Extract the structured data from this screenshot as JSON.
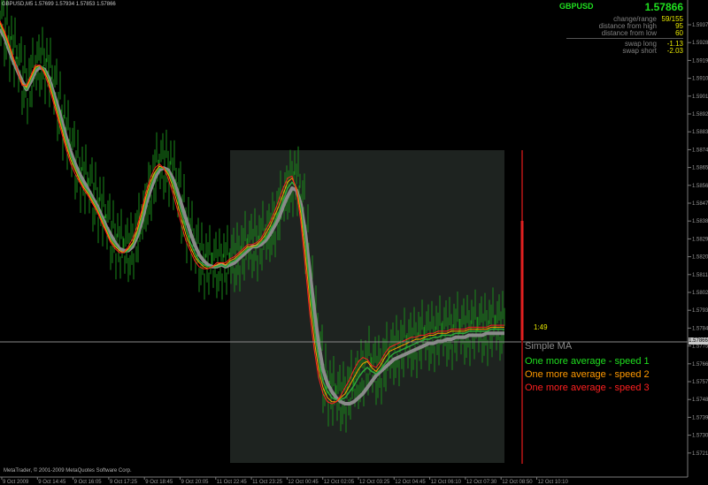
{
  "window": {
    "title": "GBPUSD,M5  1.57699 1.57934 1.57853 1.57866",
    "copyright": "MetaTrader, © 2001-2009 MetaQuotes Software Corp."
  },
  "info_panel": {
    "symbol": "GBPUSD",
    "price": "1.57866",
    "rows": [
      {
        "label": "change/range",
        "value": "59/155"
      },
      {
        "label": "distance from high",
        "value": "95"
      },
      {
        "label": "distance from low",
        "value": "60"
      },
      {
        "label": "swap long",
        "value": "-1.13"
      },
      {
        "label": "swap short",
        "value": "-2.03"
      }
    ]
  },
  "timer": "1:49",
  "current_price_tag": "1.57866",
  "legend": [
    {
      "label": "Simple MA",
      "color": "#8a8a8a"
    },
    {
      "label": "One more average - speed 1",
      "color": "#1fe01f"
    },
    {
      "label": "One more average - speed 2",
      "color": "#ff9900"
    },
    {
      "label": "One more average - speed 3",
      "color": "#ff2020"
    }
  ],
  "colors": {
    "background": "#000000",
    "bars": "#1a8a1a",
    "highlight_box": "#1e2320",
    "axis_text": "#9a9a9a",
    "red_bar": "#e02020",
    "price_line": "#8a8a8a"
  },
  "chart_data": {
    "type": "line",
    "symbol": "GBPUSD",
    "timeframe": "M5",
    "x_ticks": [
      "9 Oct 2009",
      "9 Oct 14:45",
      "9 Oct 16:05",
      "9 Oct 17:25",
      "9 Oct 18:45",
      "9 Oct 20:05",
      "11 Oct 22:45",
      "11 Oct 23:25",
      "12 Oct 00:45",
      "12 Oct 02:05",
      "12 Oct 03:25",
      "12 Oct 04:45",
      "12 Oct 06:10",
      "12 Oct 07:30",
      "12 Oct 08:50",
      "12 Oct 10:10"
    ],
    "y_ticks": [
      "1.59375",
      "1.59285",
      "1.59195",
      "1.59105",
      "1.59015",
      "1.58925",
      "1.58835",
      "1.58745",
      "1.58655",
      "1.58565",
      "1.58475",
      "1.58385",
      "1.58295",
      "1.58205",
      "1.58115",
      "1.58025",
      "1.57935",
      "1.57845",
      "1.57755",
      "1.57665",
      "1.57575",
      "1.57485",
      "1.57395",
      "1.57305",
      "1.57215"
    ],
    "ylim": [
      1.5718,
      1.5946
    ],
    "x": [
      0,
      5,
      10,
      15,
      20,
      25,
      30,
      35,
      40,
      45,
      50,
      55,
      60,
      65,
      70,
      75,
      80,
      85,
      90,
      95,
      100,
      105,
      110,
      115,
      120,
      125,
      130,
      135,
      140,
      145,
      150,
      155,
      160,
      165,
      170,
      175,
      180,
      185,
      190,
      195,
      200,
      205,
      210,
      215,
      220,
      225,
      230,
      235,
      240,
      245,
      250,
      255,
      260,
      265,
      270,
      275,
      280,
      285,
      290,
      295,
      300,
      305,
      310,
      315,
      320,
      325,
      330,
      335,
      340,
      345,
      350,
      355,
      360,
      365,
      370,
      375,
      380,
      385,
      390,
      395,
      400,
      405,
      410,
      415,
      420,
      425,
      430,
      435,
      440,
      445,
      450,
      455,
      460,
      465,
      470,
      475,
      480,
      485,
      490,
      495,
      500,
      505,
      510,
      515,
      520,
      525,
      530,
      535,
      540,
      545,
      550,
      555,
      560,
      565,
      570
    ],
    "series": [
      {
        "name": "Simple MA",
        "values": [
          1.5936,
          1.5932,
          1.5926,
          1.592,
          1.5915,
          1.591,
          1.5906,
          1.591,
          1.5915,
          1.5917,
          1.5916,
          1.5912,
          1.5905,
          1.5898,
          1.589,
          1.5882,
          1.5875,
          1.5869,
          1.5864,
          1.586,
          1.5856,
          1.5852,
          1.5848,
          1.5843,
          1.5838,
          1.5834,
          1.583,
          1.5827,
          1.5826,
          1.5826,
          1.5828,
          1.5833,
          1.584,
          1.5849,
          1.5856,
          1.5862,
          1.5866,
          1.5867,
          1.5866,
          1.5862,
          1.5856,
          1.5849,
          1.5842,
          1.5835,
          1.5829,
          1.5824,
          1.5821,
          1.5819,
          1.5818,
          1.5818,
          1.5819,
          1.5818,
          1.5819,
          1.582,
          1.5822,
          1.5824,
          1.5826,
          1.5828,
          1.5828,
          1.5829,
          1.5831,
          1.5834,
          1.5838,
          1.5842,
          1.5848,
          1.5853,
          1.5857,
          1.5856,
          1.5849,
          1.5835,
          1.5816,
          1.5797,
          1.578,
          1.5767,
          1.576,
          1.5756,
          1.5753,
          1.5751,
          1.575,
          1.575,
          1.5751,
          1.5753,
          1.5755,
          1.5758,
          1.5761,
          1.5764,
          1.5766,
          1.5768,
          1.577,
          1.5772,
          1.5773,
          1.5774,
          1.5775,
          1.5776,
          1.5777,
          1.5778,
          1.5779,
          1.578,
          1.578,
          1.5781,
          1.5781,
          1.5782,
          1.5782,
          1.5783,
          1.5783,
          1.5783,
          1.5784,
          1.5784,
          1.5784,
          1.5784,
          1.5785,
          1.5785,
          1.5785,
          1.5785,
          1.5785
        ]
      },
      {
        "name": "One more average - speed 1",
        "values": [
          1.5938,
          1.5933,
          1.5927,
          1.5921,
          1.5915,
          1.5909,
          1.5906,
          1.5911,
          1.5916,
          1.5918,
          1.5916,
          1.5911,
          1.5904,
          1.5896,
          1.5888,
          1.588,
          1.5873,
          1.5867,
          1.5862,
          1.5858,
          1.5855,
          1.5851,
          1.5847,
          1.5842,
          1.5837,
          1.5832,
          1.5829,
          1.5826,
          1.5825,
          1.5826,
          1.5829,
          1.5834,
          1.5842,
          1.5851,
          1.5858,
          1.5864,
          1.5867,
          1.5867,
          1.5865,
          1.586,
          1.5853,
          1.5845,
          1.5837,
          1.583,
          1.5825,
          1.5821,
          1.5819,
          1.5818,
          1.5818,
          1.5818,
          1.5819,
          1.5818,
          1.582,
          1.5821,
          1.5823,
          1.5825,
          1.5827,
          1.5828,
          1.5828,
          1.583,
          1.5832,
          1.5836,
          1.584,
          1.5845,
          1.5851,
          1.5857,
          1.586,
          1.5857,
          1.5847,
          1.583,
          1.5808,
          1.5788,
          1.5772,
          1.5761,
          1.5756,
          1.5753,
          1.5752,
          1.5752,
          1.5753,
          1.5756,
          1.5759,
          1.5763,
          1.5766,
          1.5768,
          1.5766,
          1.5765,
          1.5767,
          1.577,
          1.5773,
          1.5775,
          1.5776,
          1.5777,
          1.5778,
          1.5779,
          1.578,
          1.5781,
          1.5782,
          1.5782,
          1.5783,
          1.5783,
          1.5784,
          1.5784,
          1.5784,
          1.5785,
          1.5785,
          1.5785,
          1.5786,
          1.5786,
          1.5786,
          1.5786,
          1.5786,
          1.5787,
          1.5787,
          1.5787,
          1.5787
        ]
      },
      {
        "name": "One more average - speed 2",
        "values": [
          1.5939,
          1.5934,
          1.5928,
          1.5921,
          1.5915,
          1.5909,
          1.5907,
          1.5912,
          1.5917,
          1.5918,
          1.5915,
          1.591,
          1.5902,
          1.5894,
          1.5886,
          1.5878,
          1.5871,
          1.5866,
          1.5861,
          1.5857,
          1.5854,
          1.585,
          1.5846,
          1.5841,
          1.5836,
          1.5831,
          1.5828,
          1.5826,
          1.5825,
          1.5827,
          1.583,
          1.5836,
          1.5844,
          1.5853,
          1.586,
          1.5865,
          1.5868,
          1.5867,
          1.5864,
          1.5858,
          1.585,
          1.5842,
          1.5834,
          1.5828,
          1.5823,
          1.582,
          1.5818,
          1.5817,
          1.5818,
          1.5819,
          1.582,
          1.5819,
          1.5821,
          1.5822,
          1.5824,
          1.5826,
          1.5828,
          1.5828,
          1.5829,
          1.5831,
          1.5834,
          1.5838,
          1.5843,
          1.5848,
          1.5854,
          1.586,
          1.5862,
          1.5857,
          1.5844,
          1.5824,
          1.5801,
          1.5782,
          1.5767,
          1.5758,
          1.5753,
          1.5751,
          1.5751,
          1.5753,
          1.5755,
          1.5759,
          1.5763,
          1.5767,
          1.577,
          1.5771,
          1.5768,
          1.5766,
          1.5769,
          1.5773,
          1.5776,
          1.5777,
          1.5778,
          1.5779,
          1.578,
          1.5781,
          1.5782,
          1.5782,
          1.5783,
          1.5784,
          1.5784,
          1.5785,
          1.5785,
          1.5785,
          1.5786,
          1.5786,
          1.5786,
          1.5786,
          1.5787,
          1.5787,
          1.5787,
          1.5787,
          1.5787,
          1.5788,
          1.5788,
          1.5788,
          1.5788
        ]
      },
      {
        "name": "One more average - speed 3",
        "values": [
          1.594,
          1.5935,
          1.5929,
          1.5922,
          1.5915,
          1.5908,
          1.5908,
          1.5913,
          1.5918,
          1.5918,
          1.5914,
          1.5908,
          1.59,
          1.5892,
          1.5884,
          1.5876,
          1.5869,
          1.5864,
          1.586,
          1.5856,
          1.5853,
          1.5849,
          1.5845,
          1.584,
          1.5835,
          1.583,
          1.5827,
          1.5825,
          1.5825,
          1.5828,
          1.5832,
          1.5838,
          1.5846,
          1.5855,
          1.5862,
          1.5867,
          1.5869,
          1.5867,
          1.5862,
          1.5855,
          1.5847,
          1.5839,
          1.5831,
          1.5826,
          1.5821,
          1.5818,
          1.5817,
          1.5817,
          1.5818,
          1.582,
          1.582,
          1.582,
          1.5822,
          1.5823,
          1.5825,
          1.5827,
          1.5829,
          1.5829,
          1.583,
          1.5832,
          1.5836,
          1.584,
          1.5845,
          1.5851,
          1.5857,
          1.5862,
          1.5863,
          1.5856,
          1.584,
          1.5818,
          1.5795,
          1.5777,
          1.5763,
          1.5755,
          1.5751,
          1.575,
          1.5751,
          1.5754,
          1.5758,
          1.5762,
          1.5767,
          1.5771,
          1.5773,
          1.5772,
          1.5769,
          1.5768,
          1.5771,
          1.5775,
          1.5778,
          1.5779,
          1.578,
          1.5781,
          1.5782,
          1.5783,
          1.5783,
          1.5784,
          1.5784,
          1.5785,
          1.5785,
          1.5786,
          1.5786,
          1.5786,
          1.5787,
          1.5787,
          1.5787,
          1.5787,
          1.5788,
          1.5788,
          1.5788,
          1.5788,
          1.5788,
          1.5789,
          1.5789,
          1.5789,
          1.5789
        ]
      }
    ],
    "current_price": 1.57866,
    "highlight_range_x": [
      260,
      570
    ]
  }
}
